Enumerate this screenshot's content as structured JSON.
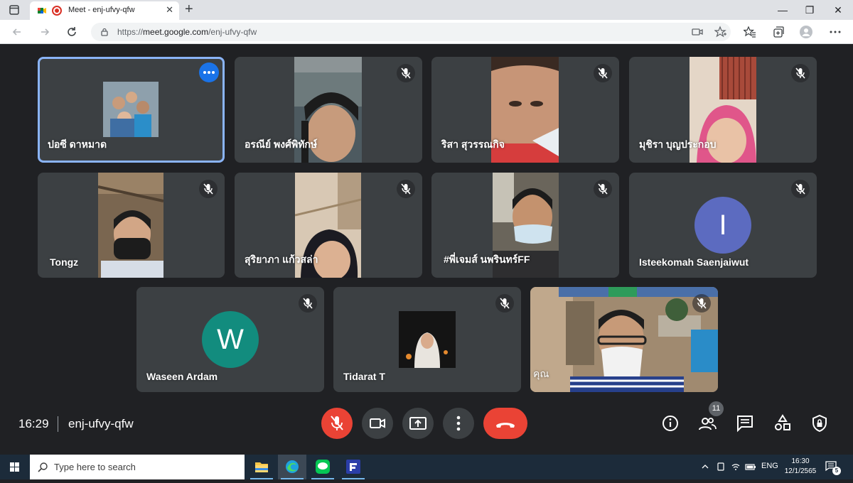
{
  "browser": {
    "tab_title": "Meet - enj-ufvy-qfw",
    "tab_close": "✕",
    "new_tab": "+",
    "url_scheme": "https://",
    "url_host": "meet.google.com",
    "url_path": "/enj-ufvy-qfw",
    "window_controls": [
      "—",
      "❐",
      "✕"
    ]
  },
  "meeting": {
    "time": "16:29",
    "code": "enj-ufvy-qfw",
    "participant_count": "11",
    "participants": [
      {
        "name": "ปอซี ดาหมาด",
        "kind": "photo-avatar",
        "active": true
      },
      {
        "name": "อรณีย์ พงศ์พิทักษ์",
        "kind": "video",
        "muted": true
      },
      {
        "name": "ริสา สุวรรณกิจ",
        "kind": "video",
        "muted": true
      },
      {
        "name": "มุชิรา บุญประกอบ",
        "kind": "video",
        "muted": true
      },
      {
        "name": "Tongz",
        "kind": "video",
        "muted": true
      },
      {
        "name": "สุริยาภา แก้วสล่า",
        "kind": "video",
        "muted": true
      },
      {
        "name": "#พี่เจมส์ นพรินทร์FF",
        "kind": "video",
        "muted": true
      },
      {
        "name": "Isteekomah Saenjaiwut",
        "kind": "letter-avatar",
        "letter": "I",
        "color": "#5c6bc0",
        "muted": true
      },
      {
        "name": "Waseen Ardam",
        "kind": "letter-avatar",
        "letter": "W",
        "color": "#128c7e",
        "muted": true
      },
      {
        "name": "Tidarat T",
        "kind": "photo-avatar",
        "muted": true
      },
      {
        "name": "คุณ",
        "kind": "video",
        "muted": true
      }
    ],
    "colors": {
      "hangup": "#ea4335",
      "mic_off": "#ea4335",
      "active_outline": "#8ab4f8",
      "more_button": "#1a73e8"
    }
  },
  "taskbar": {
    "search_placeholder": "Type here to search",
    "language": "ENG",
    "clock_time": "16:30",
    "clock_date": "12/1/2565",
    "notification_count": "5"
  }
}
